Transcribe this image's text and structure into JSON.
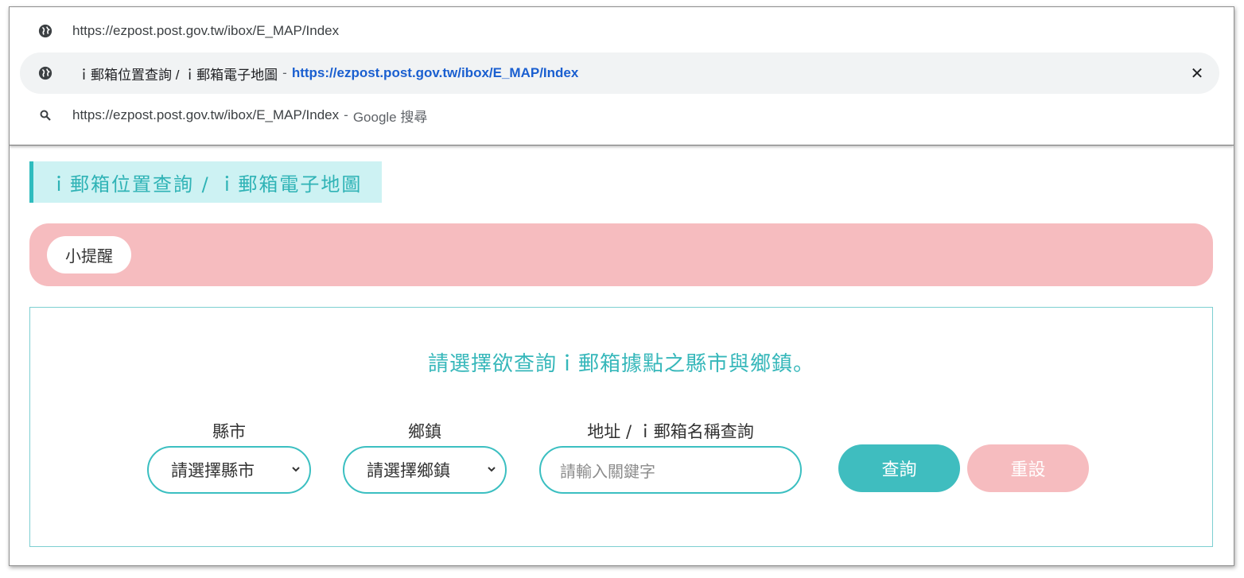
{
  "omnibox": {
    "suggestions": [
      {
        "icon": "globe-icon",
        "url": "https://ezpost.post.gov.tw/ibox/E_MAP/Index"
      },
      {
        "icon": "globe-icon",
        "title": "ｉ郵箱位置查詢 / ｉ郵箱電子地圖",
        "separator": "-",
        "link": "https://ezpost.post.gov.tw/ibox/E_MAP/Index",
        "close": "✕"
      },
      {
        "icon": "search-icon",
        "url": "https://ezpost.post.gov.tw/ibox/E_MAP/Index",
        "separator": "-",
        "suffix": "Google 搜尋"
      }
    ]
  },
  "page": {
    "heading": "ｉ郵箱位置查詢 / ｉ郵箱電子地圖",
    "notice_label": "小提醒",
    "prompt": "請選擇欲查詢ｉ郵箱據點之縣市與鄉鎮。",
    "form": {
      "county_label": "縣市",
      "county_selected": "請選擇縣市",
      "town_label": "鄉鎮",
      "town_selected": "請選擇鄉鎮",
      "address_label": "地址 / ｉ郵箱名稱查詢",
      "address_placeholder": "請輸入關鍵字",
      "search_button": "查詢",
      "reset_button": "重設"
    }
  },
  "colors": {
    "accent": "#3fbdbf",
    "heading_bg": "#cdf2f3",
    "notice_bg": "#f6bcbf",
    "link": "#1a5fd0"
  }
}
